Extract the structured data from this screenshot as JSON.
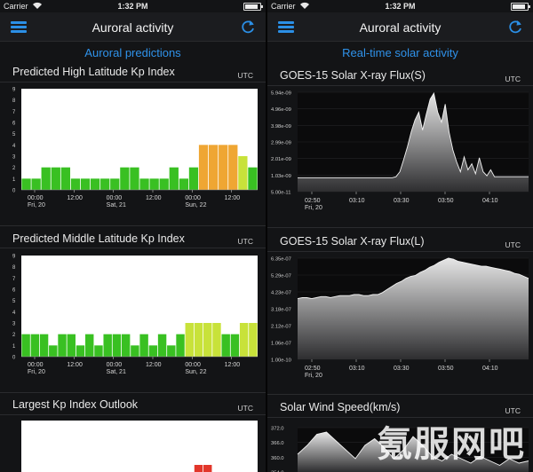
{
  "colors": {
    "accent": "#2f92ea",
    "kp_green": "#39c022",
    "kp_yellow": "#c8e23a",
    "kp_orange": "#efa633",
    "kp_red": "#e2362a"
  },
  "status": {
    "carrier": "Carrier",
    "time": "1:32 PM"
  },
  "left": {
    "nav_title": "Auroral activity",
    "section_link": "Auroral predictions",
    "utc": "UTC",
    "high_title": "Predicted High Latitude Kp Index",
    "mid_title": "Predicted Middle Latitude Kp Index",
    "outlook_title": "Largest Kp Index Outlook"
  },
  "right": {
    "nav_title": "Auroral activity",
    "section_link": "Real-time solar activity",
    "utc": "UTC",
    "xs_title": "GOES-15 Solar X-ray Flux(S)",
    "xl_title": "GOES-15 Solar X-ray Flux(L)",
    "wind_title": "Solar Wind Speed(km/s)"
  },
  "watermark": "氪服网吧",
  "chart_data": [
    {
      "type": "bar",
      "title": "Predicted High Latitude Kp Index",
      "y_ticks": [
        "0",
        "1",
        "2",
        "3",
        "4",
        "5",
        "6",
        "7",
        "8",
        "9"
      ],
      "ylim": [
        0,
        9
      ],
      "x_ticks": [
        [
          "00:00",
          "Fri, 20"
        ],
        [
          "12:00",
          ""
        ],
        [
          "00:00",
          "Sat, 21"
        ],
        [
          "12:00",
          ""
        ],
        [
          "00:00",
          "Sun, 22"
        ],
        [
          "12:00",
          ""
        ]
      ],
      "values": [
        1,
        1,
        2,
        2,
        2,
        1,
        1,
        1,
        1,
        1,
        2,
        2,
        1,
        1,
        1,
        2,
        1,
        2,
        4,
        4,
        4,
        4,
        3,
        2
      ]
    },
    {
      "type": "bar",
      "title": "Predicted Middle Latitude Kp Index",
      "y_ticks": [
        "0",
        "1",
        "2",
        "3",
        "4",
        "5",
        "6",
        "7",
        "8",
        "9"
      ],
      "ylim": [
        0,
        9
      ],
      "x_ticks": [
        [
          "00:00",
          "Fri, 20"
        ],
        [
          "12:00",
          ""
        ],
        [
          "00:00",
          "Sat, 21"
        ],
        [
          "12:00",
          ""
        ],
        [
          "00:00",
          "Sun, 22"
        ],
        [
          "12:00",
          ""
        ]
      ],
      "values": [
        2,
        2,
        2,
        1,
        2,
        2,
        1,
        2,
        1,
        2,
        2,
        2,
        1,
        2,
        1,
        2,
        1,
        2,
        3,
        3,
        3,
        3,
        2,
        2,
        3,
        3
      ]
    },
    {
      "type": "line",
      "title": "GOES-15 Solar X-ray Flux(S)",
      "y_ticks": [
        "5.00e-11",
        "1.03e-09",
        "2.01e-09",
        "2.99e-09",
        "3.98e-09",
        "4.96e-09",
        "5.94e-09"
      ],
      "x_ticks": [
        [
          "02:50",
          "Fri, 20"
        ],
        [
          "03:10",
          ""
        ],
        [
          "03:30",
          ""
        ],
        [
          "03:50",
          ""
        ],
        [
          "04:10",
          ""
        ]
      ],
      "values": [
        0.14,
        0.14,
        0.14,
        0.14,
        0.14,
        0.14,
        0.14,
        0.14,
        0.14,
        0.14,
        0.14,
        0.14,
        0.14,
        0.14,
        0.14,
        0.14,
        0.14,
        0.14,
        0.14,
        0.14,
        0.14,
        0.14,
        0.14,
        0.14,
        0.14,
        0.14,
        0.15,
        0.2,
        0.32,
        0.45,
        0.6,
        0.72,
        0.8,
        0.62,
        0.78,
        0.93,
        0.99,
        0.8,
        0.7,
        0.88,
        0.6,
        0.42,
        0.3,
        0.2,
        0.35,
        0.22,
        0.28,
        0.18,
        0.34,
        0.2,
        0.16,
        0.22,
        0.15,
        0.15,
        0.15,
        0.15,
        0.15,
        0.15,
        0.15,
        0.15,
        0.15,
        0.15
      ]
    },
    {
      "type": "line",
      "title": "GOES-15 Solar X-ray Flux(L)",
      "y_ticks": [
        "1.00e-10",
        "1.06e-07",
        "2.12e-07",
        "3.18e-07",
        "4.23e-07",
        "5.29e-07",
        "6.35e-07"
      ],
      "x_ticks": [
        [
          "02:50",
          "Fri, 20"
        ],
        [
          "03:10",
          ""
        ],
        [
          "03:30",
          ""
        ],
        [
          "03:50",
          ""
        ],
        [
          "04:10",
          ""
        ]
      ],
      "values": [
        0.6,
        0.61,
        0.61,
        0.6,
        0.61,
        0.62,
        0.62,
        0.61,
        0.62,
        0.63,
        0.63,
        0.63,
        0.64,
        0.64,
        0.63,
        0.63,
        0.64,
        0.64,
        0.66,
        0.69,
        0.72,
        0.75,
        0.77,
        0.8,
        0.82,
        0.83,
        0.86,
        0.88,
        0.91,
        0.93,
        0.96,
        0.98,
        1.0,
        0.99,
        0.97,
        0.96,
        0.95,
        0.94,
        0.93,
        0.92,
        0.92,
        0.91,
        0.9,
        0.89,
        0.88,
        0.87,
        0.85,
        0.84,
        0.82,
        0.8
      ]
    },
    {
      "type": "line",
      "title": "Solar Wind Speed(km/s)",
      "y_ticks": [
        "354.0",
        "360.0",
        "366.0",
        "372.0"
      ],
      "values": [
        0.4,
        0.6,
        0.85,
        0.9,
        0.7,
        0.5,
        0.3,
        0.6,
        0.75,
        0.55,
        0.3,
        0.5,
        0.8,
        0.6,
        0.35,
        0.25,
        0.4,
        0.3,
        0.2,
        0.35,
        0.25,
        0.15,
        0.3,
        0.2,
        0.25
      ]
    },
    {
      "type": "bar",
      "title": "Largest Kp Index Outlook",
      "values": [
        0,
        0,
        0,
        0,
        0,
        0,
        0,
        0,
        0,
        0,
        0,
        0,
        0,
        0,
        0,
        0,
        0,
        0,
        0,
        1,
        1,
        0,
        0,
        0,
        0,
        0
      ]
    }
  ]
}
